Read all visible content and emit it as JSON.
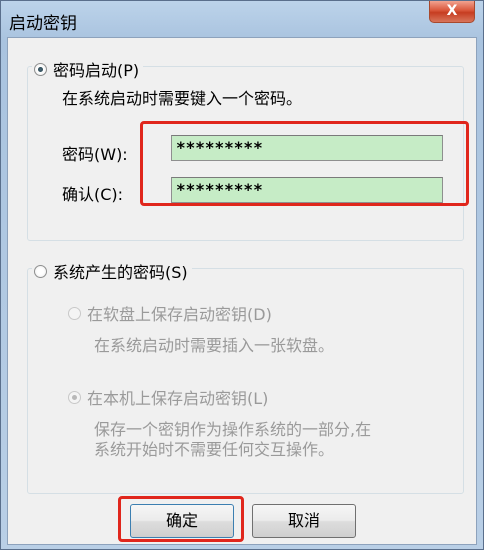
{
  "window": {
    "title": "启动密钥",
    "close_label": "X"
  },
  "password_group": {
    "label": "密码启动(P)",
    "selected": true,
    "description": "在系统启动时需要键入一个密码。",
    "password_label": "密码(W):",
    "password_value": "*********",
    "confirm_label": "确认(C):",
    "confirm_value": "*********"
  },
  "system_group": {
    "label": "系统产生的密码(S)",
    "selected": false,
    "floppy_option": {
      "label": "在软盘上保存启动密钥(D)",
      "description": "在系统启动时需要插入一张软盘。",
      "selected": false,
      "enabled": false
    },
    "local_option": {
      "label": "在本机上保存启动密钥(L)",
      "description_line1": "保存一个密钥作为操作系统的一部分,在",
      "description_line2": "系统开始时不需要任何交互操作。",
      "selected": true,
      "enabled": false
    }
  },
  "buttons": {
    "ok_label": "确定",
    "cancel_label": "取消"
  },
  "colors": {
    "highlight_frame": "#e0261c",
    "input_fill": "#c6ecc6"
  }
}
